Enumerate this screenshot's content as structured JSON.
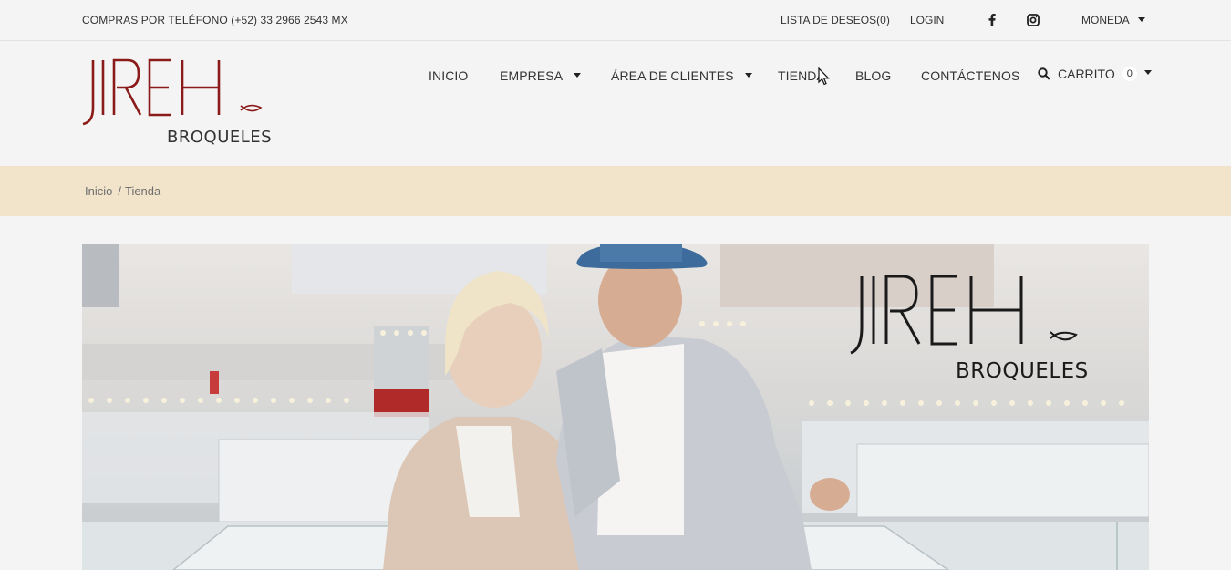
{
  "topbar": {
    "phone": "COMPRAS POR TELÉFONO (+52) 33 2966 2543 MX",
    "wishlist": "LISTA DE DESEOS(0)",
    "login": "LOGIN",
    "facebook_icon": "facebook-icon",
    "instagram_icon": "instagram-icon",
    "currency": "MONEDA"
  },
  "logo": {
    "brand": "JIREH",
    "sub": "BROQUELES",
    "color": "#8b1a1a"
  },
  "nav": {
    "items": [
      {
        "label": "INICIO"
      },
      {
        "label": "EMPRESA"
      },
      {
        "label": "ÁREA DE CLIENTES"
      },
      {
        "label": "TIENDA"
      },
      {
        "label": "BLOG"
      },
      {
        "label": "CONTÁCTENOS"
      }
    ],
    "cart_label": "CARRITO",
    "cart_count": "0"
  },
  "breadcrumb": {
    "home": "Inicio",
    "separator": "/",
    "current": "Tienda",
    "background": "#f2e4cb"
  },
  "hero": {
    "brand": "JIREH",
    "sub": "BROQUELES"
  }
}
